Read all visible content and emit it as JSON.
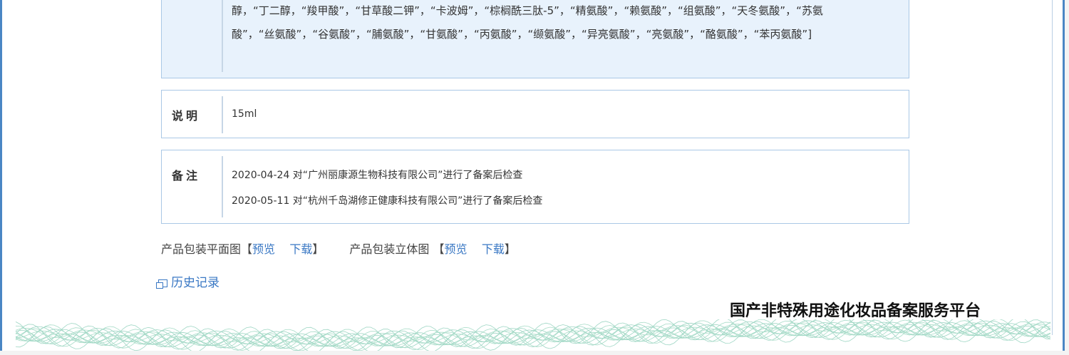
{
  "ingredients": {
    "lines": [
      "醇，“丁二醇，“羧甲酸”，“甘草酸二钾”，“卡波姆”，“棕榈酰三肽-5”，“精氨酸”，“赖氨酸”，“组氨酸”，“天冬氨酸”，“苏氨",
      "酸”，“丝氨酸”，“谷氨酸”，“脯氨酸”，“甘氨酸”，“丙氨酸”，“缬氨酸”，“异亮氨酸”，“亮氨酸”，“酪氨酸”，“苯丙氨酸”]"
    ]
  },
  "description": {
    "label": "说明",
    "value": "15ml"
  },
  "remarks": {
    "label": "备注",
    "entries": [
      "2020-04-24 对“广州丽康源生物科技有限公司”进行了备案后检查",
      "2020-05-11 对“杭州千岛湖修正健康科技有限公司”进行了备案后检查"
    ]
  },
  "packaging": {
    "flat_label": "产品包装平面图【",
    "flat_preview": "预览",
    "flat_download": "下载",
    "flat_close": "】",
    "solid_label": "产品包装立体图 【",
    "solid_preview": "预览",
    "solid_download": "下载",
    "solid_close": "】"
  },
  "history": {
    "label": "历史记录",
    "icon": "window-icon"
  },
  "footer": {
    "platform_name": "国产非特殊用途化妆品备案服务平台"
  },
  "colors": {
    "border_blue": "#4a86c4",
    "box_bg": "#e8f2fc",
    "link": "#3a78c4",
    "wave": "#9ed6c4"
  }
}
